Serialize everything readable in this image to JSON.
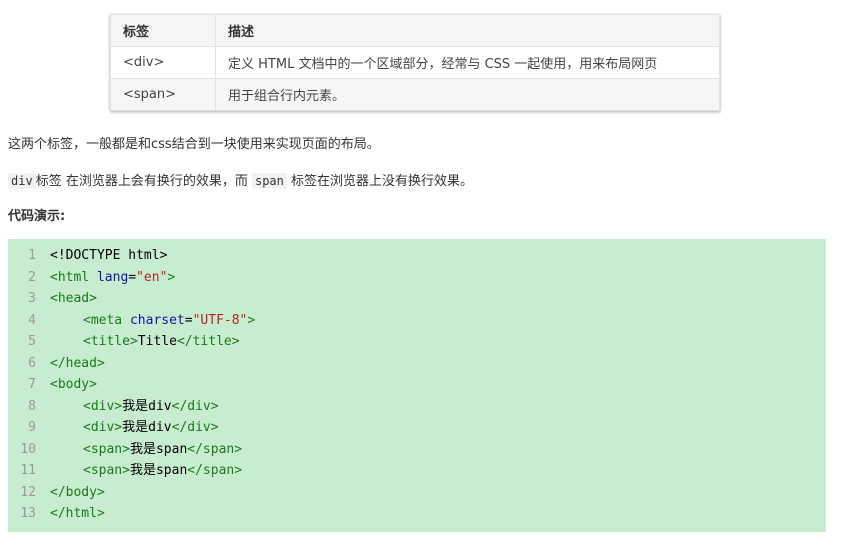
{
  "table": {
    "headers": [
      "标签",
      "描述"
    ],
    "rows": [
      [
        "<div>",
        "定义 HTML 文档中的一个区域部分，经常与 CSS 一起使用，用来布局网页"
      ],
      [
        "<span>",
        "用于组合行内元素。"
      ]
    ]
  },
  "paragraph1": "这两个标签，一般都是和css结合到一块使用来实现页面的布局。",
  "paragraph2": {
    "code1": "div",
    "text1": "标签 在浏览器上会有换行的效果，而",
    "code2": "span",
    "text2": "标签在浏览器上没有换行效果。"
  },
  "heading": "代码演示:",
  "code": {
    "line_numbers": [
      "1",
      "2",
      "3",
      "4",
      "5",
      "6",
      "7",
      "8",
      "9",
      "10",
      "11",
      "12",
      "13"
    ],
    "l1": "<!DOCTYPE html>",
    "l2_tag": "<html",
    "l2_attr": "lang",
    "l2_eq": "=",
    "l2_val": "\"en\"",
    "l2_end": ">",
    "l3": "<head>",
    "l4_tag": "<meta",
    "l4_attr": "charset",
    "l4_eq": "=",
    "l4_val": "\"UTF-8\"",
    "l4_end": ">",
    "l5_open": "<title>",
    "l5_text": "Title",
    "l5_close": "</title>",
    "l6": "</head>",
    "l7": "<body>",
    "l8_open": "<div>",
    "l8_text": "我是div",
    "l8_close": "</div>",
    "l9_open": "<div>",
    "l9_text": "我是div",
    "l9_close": "</div>",
    "l10_open": "<span>",
    "l10_text": "我是span",
    "l10_close": "</span>",
    "l11_open": "<span>",
    "l11_text": "我是span",
    "l11_close": "</span>",
    "l12": "</body>",
    "l13": "</html>"
  },
  "colors": {
    "code_background": "#c8ecd0",
    "tag": "#1a7a1a",
    "attribute": "#1414a0",
    "string": "#b22222"
  }
}
